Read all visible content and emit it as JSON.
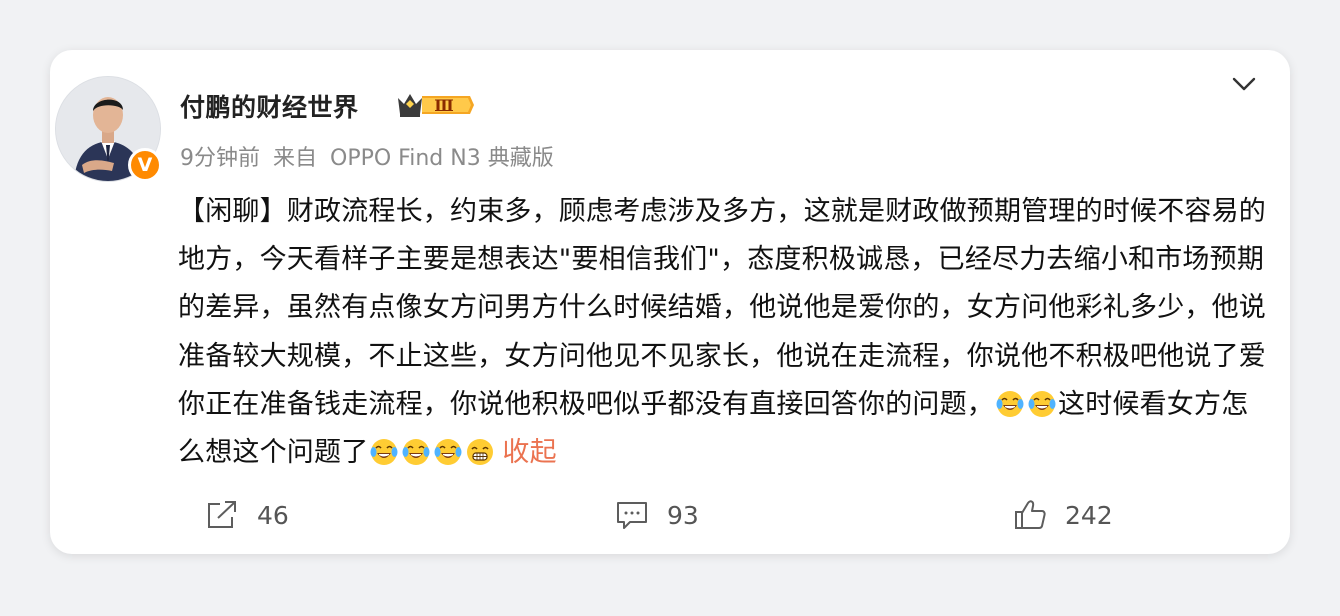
{
  "post": {
    "author": "付鹏的财经世界",
    "vip_level": "Ⅲ",
    "verified_mark": "V",
    "time": "9分钟前",
    "source_prefix": "来自",
    "source_device": "OPPO Find N3 典藏版",
    "text_main": "【闲聊】财政流程长，约束多，顾虑考虑涉及多方，这就是财政做预期管理的时候不容易的地方，今天看样子主要是想表达\"要相信我们\"，态度积极诚恳，已经尽力去缩小和市场预期的差异，虽然有点像女方问男方什么时候结婚，他说他是爱你的，女方问他彩礼多少，他说准备较大规模，不止这些，女方问他见不见家长，他说在走流程，你说他不积极吧他说了爱你正在准备钱走流程，你说他积极吧似乎都没有直接回答你的问题，",
    "text_after_emoji": "这时候看女方怎么想这个问题了",
    "collapse_label": "收起",
    "emoji_icons": [
      "laugh-cry-emoji",
      "laugh-cry-emoji",
      "laugh-cry-emoji",
      "laugh-cry-emoji",
      "laugh-cry-emoji",
      "grin-emoji"
    ]
  },
  "actions": {
    "share_count": "46",
    "comment_count": "93",
    "like_count": "242"
  },
  "colors": {
    "collapse_link": "#eb7350",
    "vip_badge": "#f5a623",
    "verified": "#ff8a00"
  }
}
